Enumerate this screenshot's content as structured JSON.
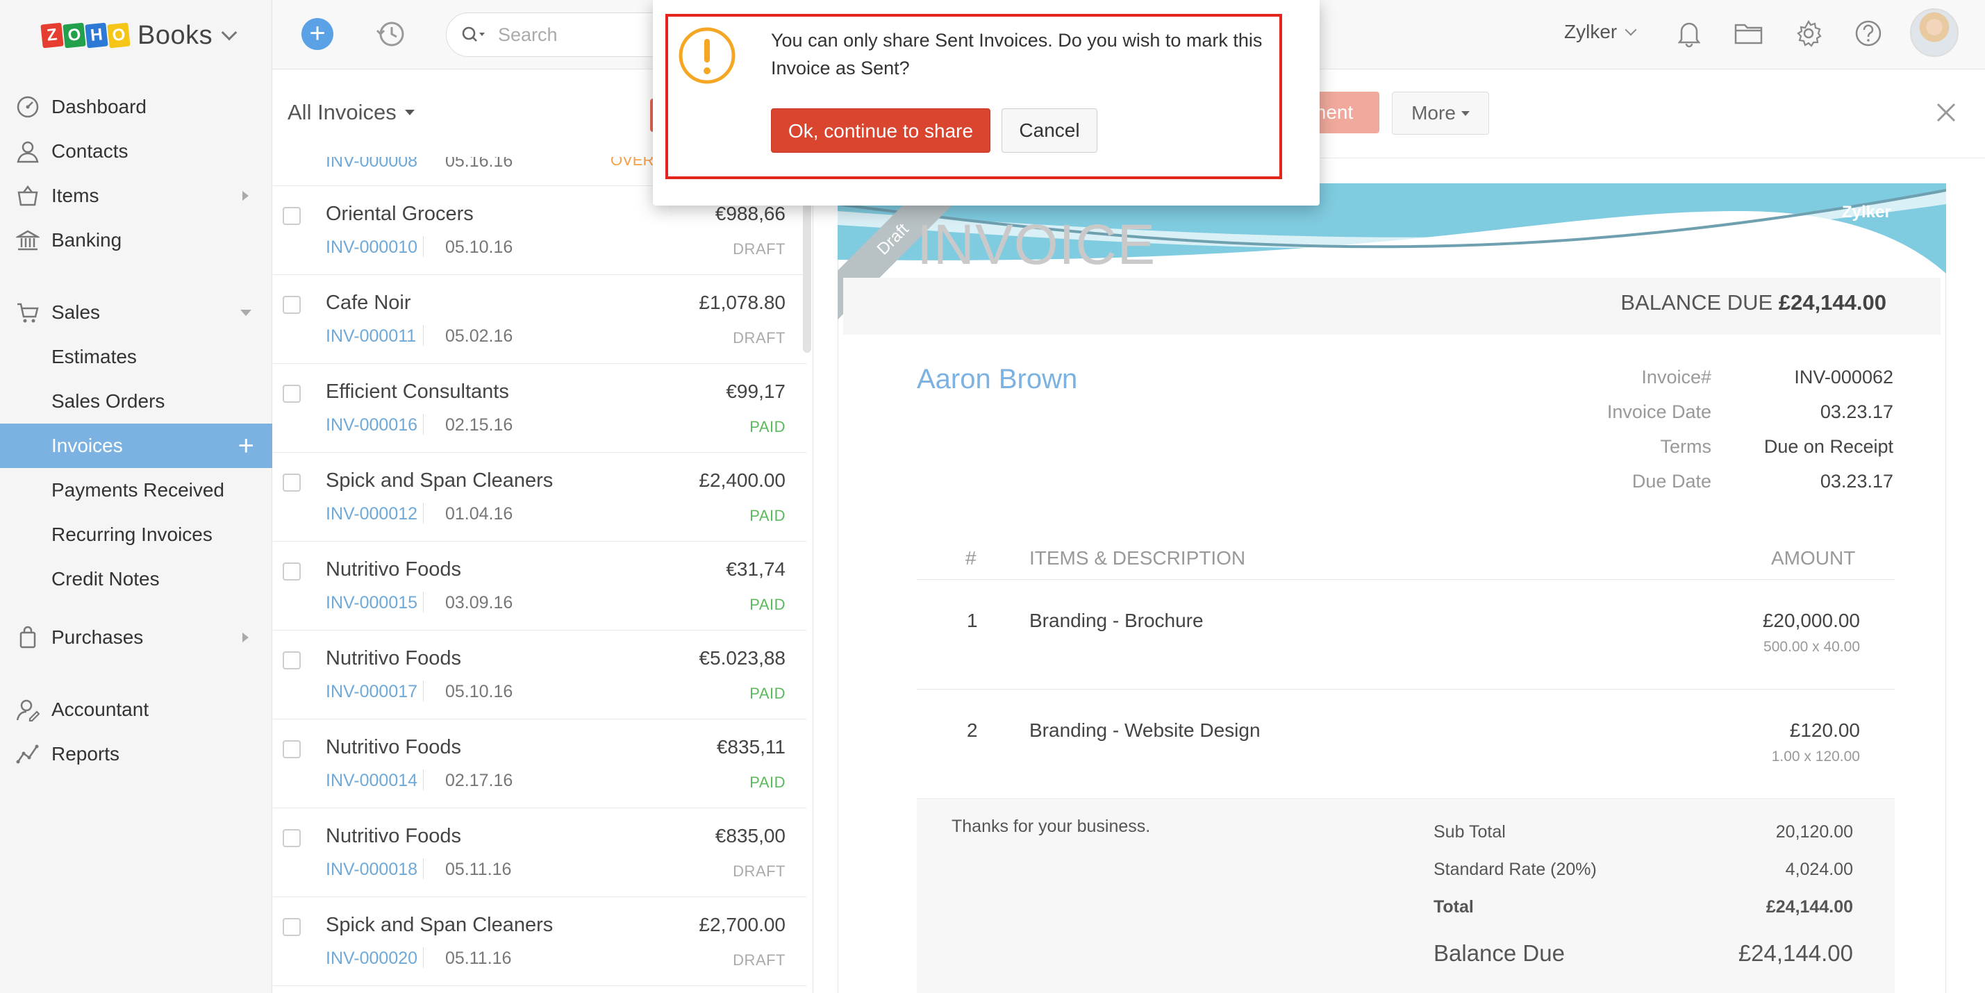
{
  "app": {
    "logo_letters": [
      "Z",
      "O",
      "H",
      "O"
    ],
    "logo_colors": [
      "#e53e30",
      "#22a04b",
      "#2c7ad6",
      "#f5c518"
    ],
    "product": "Books"
  },
  "sidebar": {
    "items": [
      {
        "label": "Dashboard",
        "icon": "dashboard-icon"
      },
      {
        "label": "Contacts",
        "icon": "contacts-icon"
      },
      {
        "label": "Items",
        "icon": "items-icon"
      },
      {
        "label": "Banking",
        "icon": "banking-icon"
      },
      {
        "label": "Sales",
        "icon": "cart-icon"
      },
      {
        "label": "Purchases",
        "icon": "bag-icon"
      },
      {
        "label": "Accountant",
        "icon": "accountant-icon"
      },
      {
        "label": "Reports",
        "icon": "reports-icon"
      }
    ],
    "sales_sub": [
      "Estimates",
      "Sales Orders",
      "Invoices",
      "Payments Received",
      "Recurring Invoices",
      "Credit Notes"
    ],
    "active_sub": "Invoices"
  },
  "topbar": {
    "search_placeholder": "Search",
    "org_name": "Zylker"
  },
  "list": {
    "title": "All Invoices",
    "partial_row": {
      "invoice": "INV-000008",
      "date": "05.16.16",
      "status": "OVER"
    },
    "rows": [
      {
        "customer": "Oriental Grocers",
        "amount": "€988,66",
        "invoice": "INV-000010",
        "date": "05.10.16",
        "status": "DRAFT"
      },
      {
        "customer": "Cafe Noir",
        "amount": "£1,078.80",
        "invoice": "INV-000011",
        "date": "05.02.16",
        "status": "DRAFT"
      },
      {
        "customer": "Efficient Consultants",
        "amount": "€99,17",
        "invoice": "INV-000016",
        "date": "02.15.16",
        "status": "PAID"
      },
      {
        "customer": "Spick and Span Cleaners",
        "amount": "£2,400.00",
        "invoice": "INV-000012",
        "date": "01.04.16",
        "status": "PAID"
      },
      {
        "customer": "Nutritivo Foods",
        "amount": "€31,74",
        "invoice": "INV-000015",
        "date": "03.09.16",
        "status": "PAID"
      },
      {
        "customer": "Nutritivo Foods",
        "amount": "€5.023,88",
        "invoice": "INV-000017",
        "date": "05.10.16",
        "status": "PAID"
      },
      {
        "customer": "Nutritivo Foods",
        "amount": "€835,11",
        "invoice": "INV-000014",
        "date": "02.17.16",
        "status": "PAID"
      },
      {
        "customer": "Nutritivo Foods",
        "amount": "€835,00",
        "invoice": "INV-000018",
        "date": "05.11.16",
        "status": "DRAFT"
      },
      {
        "customer": "Spick and Span Cleaners",
        "amount": "£2,700.00",
        "invoice": "INV-000020",
        "date": "05.11.16",
        "status": "DRAFT"
      }
    ]
  },
  "detail": {
    "record_btn_partial": "ment",
    "more_label": "More",
    "ribbon": "Draft",
    "brand_mark": "Zylker",
    "title": "INVOICE",
    "balance_label": "BALANCE DUE",
    "balance_value": "£24,144.00",
    "customer": "Aaron Brown",
    "meta": [
      {
        "key": "Invoice#",
        "value": "INV-000062"
      },
      {
        "key": "Invoice Date",
        "value": "03.23.17"
      },
      {
        "key": "Terms",
        "value": "Due on Receipt"
      },
      {
        "key": "Due Date",
        "value": "03.23.17"
      }
    ],
    "columns": {
      "num": "#",
      "desc": "ITEMS & DESCRIPTION",
      "amount": "AMOUNT"
    },
    "items": [
      {
        "num": "1",
        "desc": "Branding - Brochure",
        "amount": "£20,000.00",
        "qty": "500.00  x  40.00"
      },
      {
        "num": "2",
        "desc": "Branding - Website Design",
        "amount": "£120.00",
        "qty": "1.00  x  120.00"
      }
    ],
    "notes": "Thanks for your business.",
    "totals": [
      {
        "key": "Sub Total",
        "value": "20,120.00"
      },
      {
        "key": "Standard Rate (20%)",
        "value": "4,024.00"
      },
      {
        "key": "Total",
        "value": "£24,144.00"
      }
    ],
    "balance_due_label": "Balance Due",
    "balance_due_value": "£24,144.00"
  },
  "modal": {
    "message": "You can only share Sent Invoices. Do you wish to mark this Invoice as Sent?",
    "ok_label": "Ok, continue to share",
    "cancel_label": "Cancel"
  }
}
